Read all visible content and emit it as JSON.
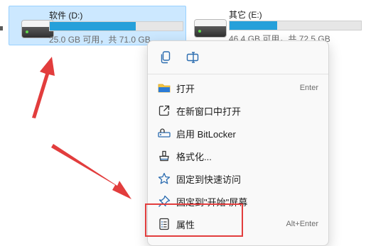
{
  "drives": [
    {
      "name": "软件 (D:)",
      "info": "25.0 GB 可用，共 71.0 GB",
      "used_fraction": 0.648,
      "selected": true
    },
    {
      "name": "其它 (E:)",
      "info": "46.4 GB 可用，共 72.5 GB",
      "used_fraction": 0.36,
      "selected": false
    }
  ],
  "context_menu": {
    "quick_actions": [
      "copy-icon",
      "rename-icon"
    ],
    "items": [
      {
        "icon": "folder-icon",
        "label": "打开",
        "shortcut": "Enter"
      },
      {
        "icon": "open-new-window-icon",
        "label": "在新窗口中打开",
        "shortcut": ""
      },
      {
        "icon": "bitlocker-key-icon",
        "label": "启用 BitLocker",
        "shortcut": ""
      },
      {
        "icon": "format-drive-icon",
        "label": "格式化...",
        "shortcut": ""
      },
      {
        "icon": "star-icon",
        "label": "固定到快速访问",
        "shortcut": ""
      },
      {
        "icon": "pin-icon",
        "label": "固定到\"开始\"屏幕",
        "shortcut": ""
      },
      {
        "icon": "properties-icon",
        "label": "属性",
        "shortcut": "Alt+Enter"
      }
    ]
  },
  "colors": {
    "selection_bg": "#cce8ff",
    "bar_fill": "#26a0da",
    "annotation_red": "#e23d3d",
    "icon_blue": "#2b6cb0",
    "folder_yellow": "#f4c542"
  }
}
